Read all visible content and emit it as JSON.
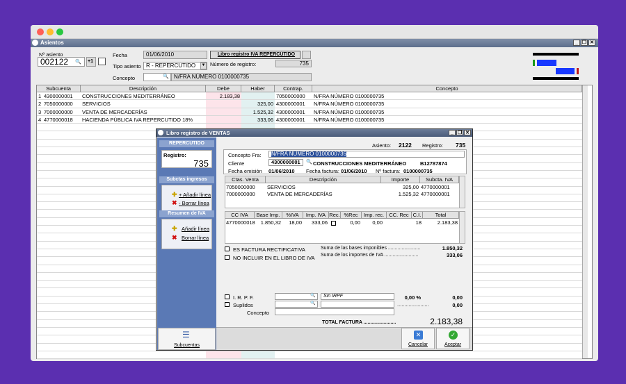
{
  "window": {
    "title": "Asientos",
    "controls": [
      "_",
      "🗗",
      "X"
    ]
  },
  "header": {
    "asiento_label": "Nº asiento",
    "asiento_value": "002122",
    "plus_one": "+1",
    "fecha_label": "Fecha",
    "fecha_value": "01/06/2010",
    "tipo_label": "Tipo asiento",
    "tipo_value": "R - REPERCUTIDO",
    "concepto_label": "Concepto",
    "concepto_value": "N/FRA NÚMERO 0100000735",
    "libro_button": "Libro registro IVA REPERCUTIDO",
    "num_registro_label": "Número de registro:",
    "num_registro_value": "735"
  },
  "grid": {
    "columns": [
      "Subcuenta",
      "Descripción",
      "Debe",
      "Haber",
      "Contrap.",
      "Concepto"
    ],
    "rows": [
      {
        "n": "1",
        "subcuenta": "4300000001",
        "descripcion": "CONSTRUCCIONES MEDITERRÁNEO",
        "debe": "2.183,38",
        "haber": "",
        "contrap": "7050000000",
        "concepto": "N/FRA NÚMERO 0100000735"
      },
      {
        "n": "2",
        "subcuenta": "7050000000",
        "descripcion": "SERVICIOS",
        "debe": "",
        "haber": "325,00",
        "contrap": "4300000001",
        "concepto": "N/FRA NÚMERO 0100000735"
      },
      {
        "n": "3",
        "subcuenta": "7000000000",
        "descripcion": "VENTA DE MERCADERÍAS",
        "debe": "",
        "haber": "1.525,32",
        "contrap": "4300000001",
        "concepto": "N/FRA NÚMERO 0100000735"
      },
      {
        "n": "4",
        "subcuenta": "4770000018",
        "descripcion": "HACIENDA PÚBLICA IVA REPERCUTIDO 18%",
        "debe": "",
        "haber": "333,06",
        "contrap": "4300000001",
        "concepto": "N/FRA NÚMERO 0100000735"
      }
    ]
  },
  "dialog": {
    "title": "Libro registro de VENTAS",
    "left": {
      "repercutido": "REPERCUTIDO",
      "registro_label": "Registro:",
      "registro_value": "735",
      "subctas_header": "Subctas ingresos",
      "add_line": "+ Añadir línea",
      "del_line": "- Borrar línea",
      "resumen_header": "Resumen de IVA",
      "add_line2": "Añadir línea",
      "del_line2": "Borrar línea",
      "subcuentas": "Subcuentas"
    },
    "top": {
      "asiento_label": "Asiento:",
      "asiento_value": "2122",
      "registro_label": "Registro:",
      "registro_value": "735"
    },
    "info": {
      "concepto_label": "Concepto Fra:",
      "concepto_value": "N/FRA NÚMERO 0100000735",
      "cliente_label": "Cliente",
      "cliente_code": "4300000001",
      "cliente_name": "CONSTRUCCIONES MEDITERRÁNEO",
      "cliente_nif": "B12787874",
      "emision_label": "Fecha emisión",
      "emision_value": "01/06/2010",
      "fecha_factura_label": "Fecha factura:",
      "fecha_factura_value": "01/06/2010",
      "nfactura_label": "Nº factura:",
      "nfactura_value": "0100000735"
    },
    "ventas": {
      "columns": [
        "Ctas. Venta",
        "Descripción",
        "Importe",
        "Subcta. IVA"
      ],
      "rows": [
        {
          "cta": "7050000000",
          "desc": "SERVICIOS",
          "importe": "325,00",
          "iva": "4770000001"
        },
        {
          "cta": "7000000000",
          "desc": "VENTA DE MERCADERÍAS",
          "importe": "1.525,32",
          "iva": "4770000001"
        }
      ]
    },
    "iva": {
      "columns": [
        "CC IVA",
        "Base Imp.",
        "%IVA",
        "Imp. IVA",
        "Rec.",
        "%Rec",
        "Imp. rec.",
        "CC. Rec",
        "C.I.",
        "Total"
      ],
      "row": {
        "cc": "4770000018",
        "base": "1.850,32",
        "piva": "18,00",
        "imp": "333,06",
        "prec": "0,00",
        "imprec": "0,00",
        "ci": "18",
        "total": "2.183,38"
      }
    },
    "checks": {
      "rectificativa": "ES FACTURA RECTIFICATIVA",
      "no_incluir": "NO INCLUIR EN EL LIBRO DE IVA",
      "suma_bases_label": "Suma de las bases imponibles ........................",
      "suma_bases_value": "1.850,32",
      "suma_iva_label": "Suma de los importes de IVA .........................",
      "suma_iva_value": "333,06"
    },
    "irpf": {
      "irpf_label": "I. R. P. F.",
      "sin_irpf": "Sin IRPF",
      "irpf_pct": "0,00 %",
      "irpf_value": "0,00",
      "suplidos_label": "Suplidos",
      "suplidos_dots": "......................",
      "suplidos_value": "0,00",
      "concepto_label": "Concepto"
    },
    "total_label": "TOTAL FACTURA ........................",
    "total_value": "2.183,38",
    "cancelar": "Cancelar",
    "aceptar": "Aceptar"
  }
}
